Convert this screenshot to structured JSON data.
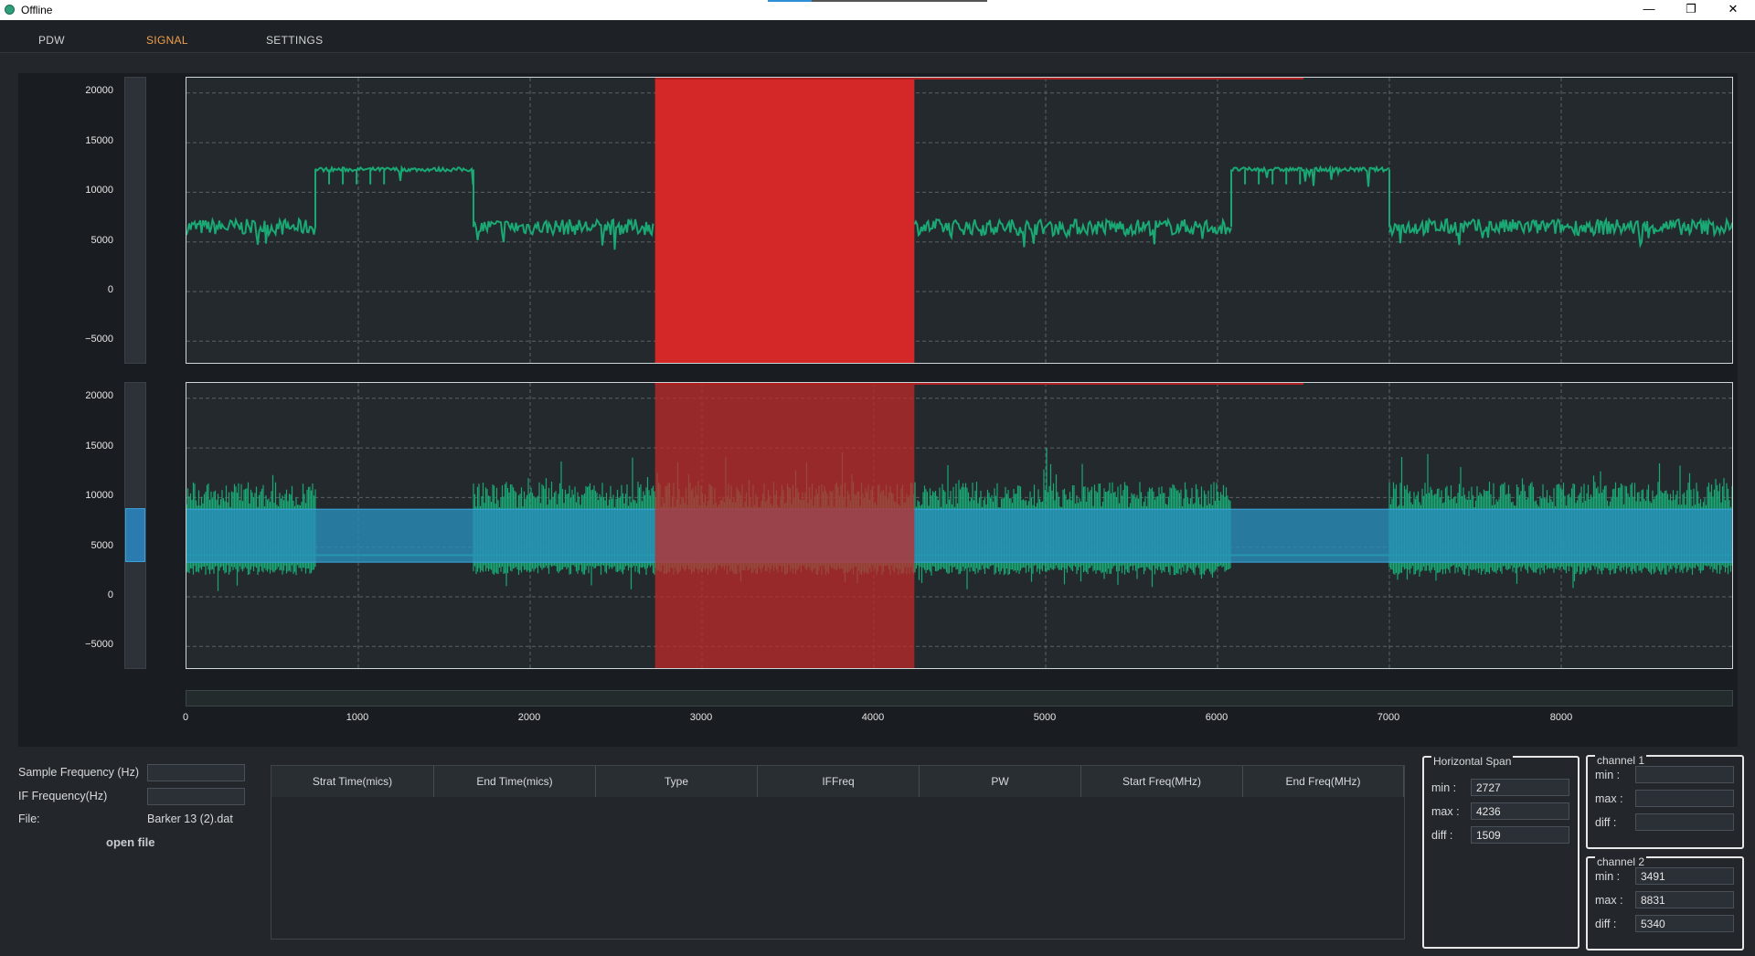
{
  "window": {
    "title": "Offline",
    "minimize_glyph": "—",
    "maximize_glyph": "❐",
    "close_glyph": "✕",
    "app_icon": "green-circle-icon"
  },
  "menu": {
    "items": [
      {
        "label": "PDW",
        "active": false
      },
      {
        "label": "SIGNAL",
        "active": true
      },
      {
        "label": "SETTINGS",
        "active": false
      }
    ],
    "active_color": "#f0a04b"
  },
  "charts": {
    "y_ticks": [
      "20000",
      "15000",
      "10000",
      "5000",
      "0",
      "−5000"
    ],
    "x_ticks": [
      "0",
      "1000",
      "2000",
      "3000",
      "4000",
      "5000",
      "6000",
      "7000",
      "8000"
    ]
  },
  "chart_data": [
    {
      "type": "line",
      "name": "top-signal",
      "xlim": [
        0,
        9000
      ],
      "ylim": [
        -7500,
        21000
      ],
      "color": "#1aa874",
      "segments": [
        {
          "x": [
            0,
            750
          ],
          "level": 6500
        },
        {
          "x": [
            750,
            1670
          ],
          "level": 12300
        },
        {
          "x": [
            1670,
            2720
          ],
          "level": 6500
        },
        {
          "x": [
            4236,
            6080
          ],
          "level": 6500
        },
        {
          "x": [
            6080,
            7000
          ],
          "level": 12300
        },
        {
          "x": [
            7000,
            9000
          ],
          "level": 6500
        }
      ],
      "selection": {
        "min": 2727,
        "max": 4236,
        "color": "#d42828"
      }
    },
    {
      "type": "area",
      "name": "bottom-signal",
      "xlim": [
        0,
        9000
      ],
      "ylim": [
        -7500,
        21000
      ],
      "color": "#1aa874",
      "high_regions": [
        [
          0,
          750
        ],
        [
          1670,
          6080
        ],
        [
          7000,
          9000
        ]
      ],
      "band": {
        "min": 3491,
        "max": 8831,
        "color": "#2a8fbf"
      },
      "selection": {
        "min": 2727,
        "max": 4236,
        "color": "#c02a2a"
      }
    }
  ],
  "file_panel": {
    "sample_freq_label": "Sample Frequency (Hz)",
    "sample_freq_value": "",
    "if_freq_label": "IF Frequency(Hz)",
    "if_freq_value": "",
    "file_label": "File:",
    "file_value": "Barker 13 (2).dat",
    "open_file_label": "open file"
  },
  "table": {
    "columns": [
      "Strat Time(mics)",
      "End Time(mics)",
      "Type",
      "IFFreq",
      "PW",
      "Start Freq(MHz)",
      "End Freq(MHz)"
    ],
    "rows": []
  },
  "horizontal_span": {
    "title": "Horizontal Span",
    "min_label": "min :",
    "min_value": "2727",
    "max_label": "max :",
    "max_value": "4236",
    "diff_label": "diff :",
    "diff_value": "1509"
  },
  "channel1": {
    "title": "channel 1",
    "min_label": "min :",
    "min_value": "",
    "max_label": "max :",
    "max_value": "",
    "diff_label": "diff :",
    "diff_value": ""
  },
  "channel2": {
    "title": "channel 2",
    "min_label": "min :",
    "min_value": "3491",
    "max_label": "max :",
    "max_value": "8831",
    "diff_label": "diff :",
    "diff_value": "5340"
  }
}
